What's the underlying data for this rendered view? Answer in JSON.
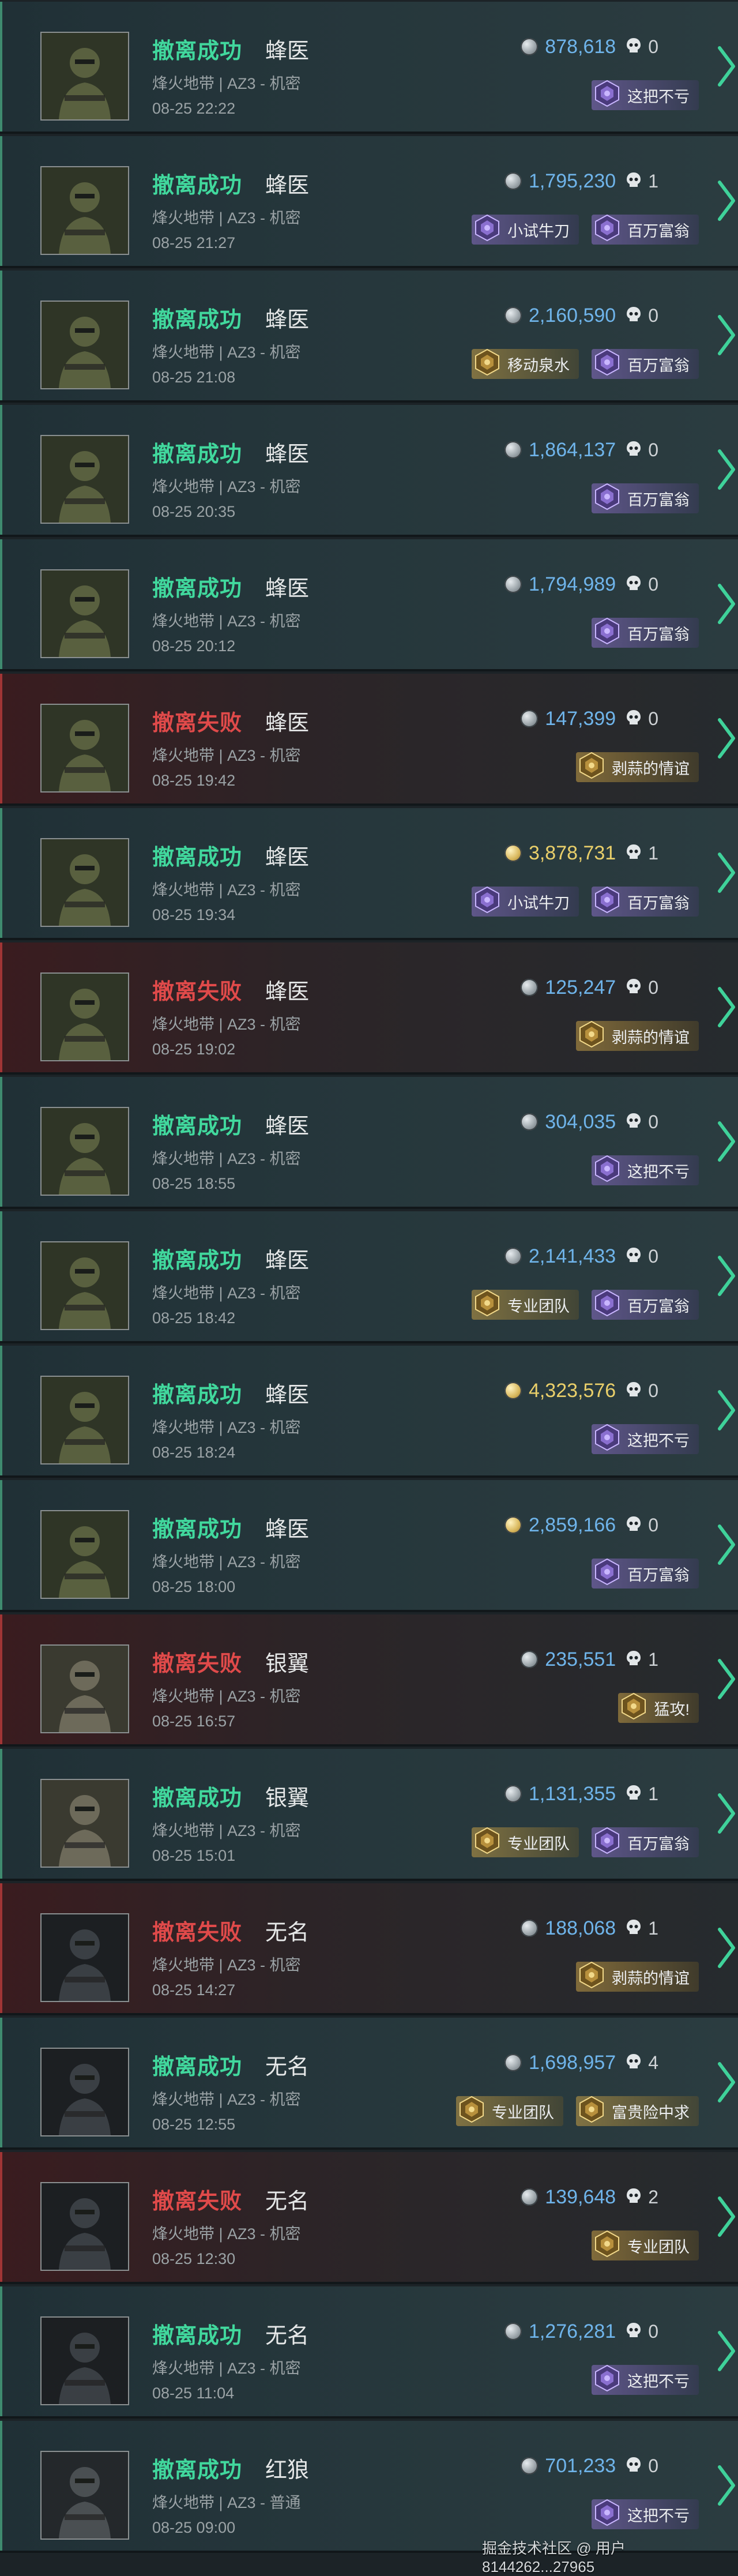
{
  "colors": {
    "success": "#41d89d",
    "fail": "#e04a4a",
    "value_blue": "#6fb4ea",
    "value_gold": "#e9cf6a"
  },
  "records": [
    {
      "status": "撤离成功",
      "result": "success",
      "operator": "蜂医",
      "avatar": "medic-soldier",
      "map": "烽火地带 | AZ3 - 机密",
      "time": "08-25 22:22",
      "value": "878,618",
      "coin": "silver",
      "value_color": "blue",
      "kills": "0",
      "badges": [
        {
          "label": "这把不亏",
          "tier": "purple"
        }
      ]
    },
    {
      "status": "撤离成功",
      "result": "success",
      "operator": "蜂医",
      "avatar": "medic-soldier",
      "map": "烽火地带 | AZ3 - 机密",
      "time": "08-25 21:27",
      "value": "1,795,230",
      "coin": "silver",
      "value_color": "blue",
      "kills": "1",
      "badges": [
        {
          "label": "小试牛刀",
          "tier": "purple"
        },
        {
          "label": "百万富翁",
          "tier": "purple"
        }
      ]
    },
    {
      "status": "撤离成功",
      "result": "success",
      "operator": "蜂医",
      "avatar": "medic-soldier",
      "map": "烽火地带 | AZ3 - 机密",
      "time": "08-25 21:08",
      "value": "2,160,590",
      "coin": "silver",
      "value_color": "blue",
      "kills": "0",
      "badges": [
        {
          "label": "移动泉水",
          "tier": "gold"
        },
        {
          "label": "百万富翁",
          "tier": "purple"
        }
      ]
    },
    {
      "status": "撤离成功",
      "result": "success",
      "operator": "蜂医",
      "avatar": "medic-soldier",
      "map": "烽火地带 | AZ3 - 机密",
      "time": "08-25 20:35",
      "value": "1,864,137",
      "coin": "silver",
      "value_color": "blue",
      "kills": "0",
      "badges": [
        {
          "label": "百万富翁",
          "tier": "purple"
        }
      ]
    },
    {
      "status": "撤离成功",
      "result": "success",
      "operator": "蜂医",
      "avatar": "medic-soldier",
      "map": "烽火地带 | AZ3 - 机密",
      "time": "08-25 20:12",
      "value": "1,794,989",
      "coin": "silver",
      "value_color": "blue",
      "kills": "0",
      "badges": [
        {
          "label": "百万富翁",
          "tier": "purple"
        }
      ]
    },
    {
      "status": "撤离失败",
      "result": "fail",
      "operator": "蜂医",
      "avatar": "medic-soldier",
      "map": "烽火地带 | AZ3 - 机密",
      "time": "08-25 19:42",
      "value": "147,399",
      "coin": "silver",
      "value_color": "blue",
      "kills": "0",
      "badges": [
        {
          "label": "剥蒜的情谊",
          "tier": "gold"
        }
      ]
    },
    {
      "status": "撤离成功",
      "result": "success",
      "operator": "蜂医",
      "avatar": "medic-soldier",
      "map": "烽火地带 | AZ3 - 机密",
      "time": "08-25 19:34",
      "value": "3,878,731",
      "coin": "gold",
      "value_color": "gold",
      "kills": "1",
      "badges": [
        {
          "label": "小试牛刀",
          "tier": "purple"
        },
        {
          "label": "百万富翁",
          "tier": "purple"
        }
      ]
    },
    {
      "status": "撤离失败",
      "result": "fail",
      "operator": "蜂医",
      "avatar": "medic-soldier",
      "map": "烽火地带 | AZ3 - 机密",
      "time": "08-25 19:02",
      "value": "125,247",
      "coin": "silver",
      "value_color": "blue",
      "kills": "0",
      "badges": [
        {
          "label": "剥蒜的情谊",
          "tier": "gold"
        }
      ]
    },
    {
      "status": "撤离成功",
      "result": "success",
      "operator": "蜂医",
      "avatar": "medic-soldier",
      "map": "烽火地带 | AZ3 - 机密",
      "time": "08-25 18:55",
      "value": "304,035",
      "coin": "silver",
      "value_color": "blue",
      "kills": "0",
      "badges": [
        {
          "label": "这把不亏",
          "tier": "purple"
        }
      ]
    },
    {
      "status": "撤离成功",
      "result": "success",
      "operator": "蜂医",
      "avatar": "medic-soldier",
      "map": "烽火地带 | AZ3 - 机密",
      "time": "08-25 18:42",
      "value": "2,141,433",
      "coin": "silver",
      "value_color": "blue",
      "kills": "0",
      "badges": [
        {
          "label": "专业团队",
          "tier": "gold"
        },
        {
          "label": "百万富翁",
          "tier": "purple"
        }
      ]
    },
    {
      "status": "撤离成功",
      "result": "success",
      "operator": "蜂医",
      "avatar": "medic-soldier",
      "map": "烽火地带 | AZ3 - 机密",
      "time": "08-25 18:24",
      "value": "4,323,576",
      "coin": "gold",
      "value_color": "gold",
      "kills": "0",
      "badges": [
        {
          "label": "这把不亏",
          "tier": "purple"
        }
      ]
    },
    {
      "status": "撤离成功",
      "result": "success",
      "operator": "蜂医",
      "avatar": "medic-soldier",
      "map": "烽火地带 | AZ3 - 机密",
      "time": "08-25 18:00",
      "value": "2,859,166",
      "coin": "gold",
      "value_color": "blue",
      "kills": "0",
      "badges": [
        {
          "label": "百万富翁",
          "tier": "purple"
        }
      ]
    },
    {
      "status": "撤离失败",
      "result": "fail",
      "operator": "银翼",
      "avatar": "wing-soldier",
      "map": "烽火地带 | AZ3 - 机密",
      "time": "08-25 16:57",
      "value": "235,551",
      "coin": "silver",
      "value_color": "blue",
      "kills": "1",
      "badges": [
        {
          "label": "猛攻!",
          "tier": "gold"
        }
      ]
    },
    {
      "status": "撤离成功",
      "result": "success",
      "operator": "银翼",
      "avatar": "wing-soldier",
      "map": "烽火地带 | AZ3 - 机密",
      "time": "08-25 15:01",
      "value": "1,131,355",
      "coin": "silver",
      "value_color": "blue",
      "kills": "1",
      "badges": [
        {
          "label": "专业团队",
          "tier": "gold"
        },
        {
          "label": "百万富翁",
          "tier": "purple"
        }
      ]
    },
    {
      "status": "撤离失败",
      "result": "fail",
      "operator": "无名",
      "avatar": "masked-soldier",
      "map": "烽火地带 | AZ3 - 机密",
      "time": "08-25 14:27",
      "value": "188,068",
      "coin": "silver",
      "value_color": "blue",
      "kills": "1",
      "badges": [
        {
          "label": "剥蒜的情谊",
          "tier": "gold"
        }
      ]
    },
    {
      "status": "撤离成功",
      "result": "success",
      "operator": "无名",
      "avatar": "masked-soldier",
      "map": "烽火地带 | AZ3 - 机密",
      "time": "08-25 12:55",
      "value": "1,698,957",
      "coin": "silver",
      "value_color": "blue",
      "kills": "4",
      "badges": [
        {
          "label": "专业团队",
          "tier": "gold"
        },
        {
          "label": "富贵险中求",
          "tier": "gold"
        }
      ]
    },
    {
      "status": "撤离失败",
      "result": "fail",
      "operator": "无名",
      "avatar": "masked-soldier",
      "map": "烽火地带 | AZ3 - 机密",
      "time": "08-25 12:30",
      "value": "139,648",
      "coin": "silver",
      "value_color": "blue",
      "kills": "2",
      "badges": [
        {
          "label": "专业团队",
          "tier": "gold"
        }
      ]
    },
    {
      "status": "撤离成功",
      "result": "success",
      "operator": "无名",
      "avatar": "masked-soldier",
      "map": "烽火地带 | AZ3 - 机密",
      "time": "08-25 11:04",
      "value": "1,276,281",
      "coin": "silver",
      "value_color": "blue",
      "kills": "0",
      "badges": [
        {
          "label": "这把不亏",
          "tier": "purple"
        }
      ]
    },
    {
      "status": "撤离成功",
      "result": "success",
      "operator": "红狼",
      "avatar": "wolf-soldier",
      "map": "烽火地带 | AZ3 - 普通",
      "time": "08-25 09:00",
      "value": "701,233",
      "coin": "silver",
      "value_color": "blue",
      "kills": "0",
      "badges": [
        {
          "label": "这把不亏",
          "tier": "purple"
        }
      ]
    }
  ],
  "watermark": "掘金技术社区 @ 用户8144262...27965"
}
